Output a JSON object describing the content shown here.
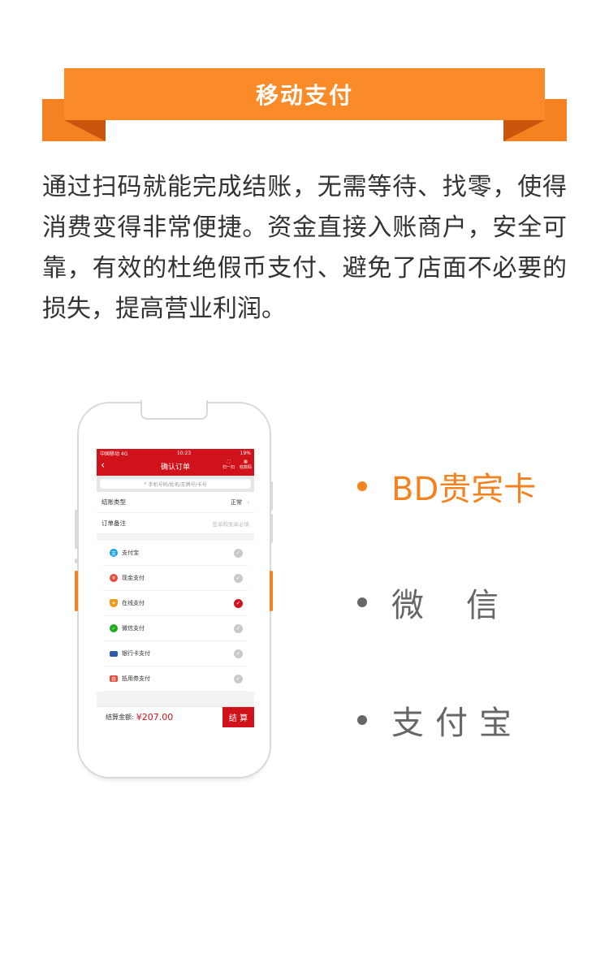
{
  "banner": {
    "title": "移动支付"
  },
  "description": "通过扫码就能完成结账，无需等待、找零，使得消费变得非常便捷。资金直接入账商户，安全可靠，有效的杜绝假币支付、避免了店面不必要的损失，提高营业利润。",
  "phone": {
    "status_carrier": "中国移动  4G",
    "status_time": "10:23",
    "status_battery": "19%",
    "nav_title": "确认订单",
    "nav_scan": "扫一扫",
    "nav_qr": "收款码",
    "search_placeholder": "手机号码/姓名/车牌号/卡号",
    "rows": [
      {
        "label": "结账类型",
        "value": "正常"
      },
      {
        "label": "订单备注",
        "value": "签单和免单必填"
      }
    ],
    "payments": [
      {
        "label": "支付宝",
        "icon": "alipay-icon",
        "color": "#1aa1e6",
        "selected": false
      },
      {
        "label": "现金支付",
        "icon": "cash-icon",
        "color": "#e84b3c",
        "selected": false
      },
      {
        "label": "在线支付",
        "icon": "shield-icon",
        "color": "#f09a1a",
        "selected": true
      },
      {
        "label": "微信支付",
        "icon": "wechat-icon",
        "color": "#1aad19",
        "selected": false
      },
      {
        "label": "银行卡支付",
        "icon": "bank-card-icon",
        "color": "#2a5caa",
        "selected": false
      },
      {
        "label": "抵用券支付",
        "icon": "coupon-icon",
        "color": "#e84b3c",
        "selected": false
      }
    ],
    "footer_label": "结算金额:",
    "footer_amount": "¥207.00",
    "footer_button": "结 算"
  },
  "features": [
    {
      "label": "BD贵宾卡",
      "active": true
    },
    {
      "label": "微　信",
      "active": false
    },
    {
      "label": "支付宝",
      "active": false
    }
  ],
  "colors": {
    "accent": "#f58220",
    "brand_red": "#d0121b"
  }
}
